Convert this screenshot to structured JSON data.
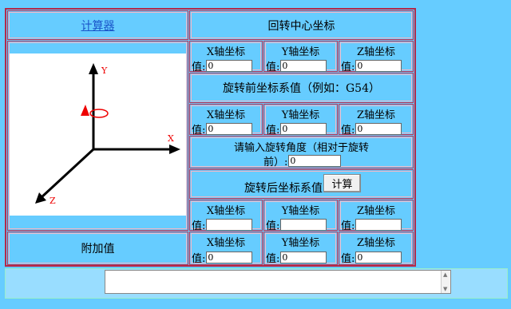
{
  "left": {
    "calculator_link": "计算器",
    "extra_value_label": "附加值",
    "diagram_axes": {
      "x": "X",
      "y": "Y",
      "z": "Z"
    }
  },
  "rotation_center": {
    "title": "回转中心坐标",
    "x_label": "X轴坐标",
    "y_label": "Y轴坐标",
    "z_label": "Z轴坐标",
    "value_prefix": "值:",
    "x_value": "0",
    "y_value": "0",
    "z_value": "0"
  },
  "before_system": {
    "title": "旋转前坐标系值（例如：G54）",
    "x_label": "X轴坐标",
    "y_label": "Y轴坐标",
    "z_label": "Z轴坐标",
    "value_prefix": "值:",
    "x_value": "0",
    "y_value": "0",
    "z_value": "0"
  },
  "angle": {
    "prompt_line1": "请输入旋转角度（相对于旋转",
    "prompt_line2": "前）:",
    "value": "0"
  },
  "after_system": {
    "title": "旋转后坐标系值",
    "calc_button": "计算",
    "x_label": "X轴坐标",
    "y_label": "Y轴坐标",
    "z_label": "Z轴坐标",
    "value_prefix": "值:",
    "x_value": "",
    "y_value": "",
    "z_value": ""
  },
  "extra": {
    "x_label": "X轴坐标",
    "y_label": "Y轴坐标",
    "z_label": "Z轴坐标",
    "value_prefix": "值:",
    "x_value": "0",
    "y_value": "0",
    "z_value": "0"
  },
  "output": {
    "text": ""
  }
}
